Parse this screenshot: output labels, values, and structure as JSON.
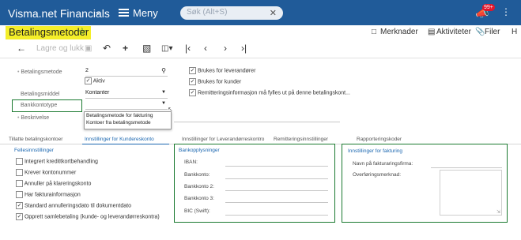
{
  "topbar": {
    "app_name": "Visma.net Financials",
    "menu_label": "Meny",
    "search_placeholder": "Søk (Alt+S)",
    "notification_count": "99+"
  },
  "header": {
    "title": "Betalingsmetoder",
    "actions": [
      "Merknader",
      "Aktiviteter",
      "Filer",
      "H"
    ]
  },
  "toolbar": {
    "save_close": "Lagre og lukk"
  },
  "form": {
    "betalingsmetode_label": "Betalingsmetode",
    "betalingsmetode_value": "2",
    "aktiv_label": "Aktiv",
    "betalingsmiddel_label": "Betalingsmiddel",
    "betalingsmiddel_value": "Kontanter",
    "bankkontotype_label": "Bankkontotype",
    "beskrivelse_label": "Beskrivelse",
    "checks_right": [
      "Brukes for leverandører",
      "Brukes for kunder",
      "Remitteringsinformasjon må fylles ut på denne betalingskont..."
    ],
    "dropdown_options": [
      "Betalingsmetode for fakturing",
      "Kontoer fra betalingsmetode"
    ]
  },
  "tabs": [
    "Tillatte betalingskontoer",
    "Innstillinger for Kundereskonto",
    "Innstillinger for Leverandørreskontro",
    "Remitteringsinnstillinger",
    "Rapporteringskoder"
  ],
  "fellesinnstillinger": {
    "title": "Fellesinnstillinger",
    "items": [
      {
        "label": "Integrert kredittkortbehandling",
        "checked": false
      },
      {
        "label": "Krever kontonummer",
        "checked": false
      },
      {
        "label": "Annuller på klareringskonto",
        "checked": false
      },
      {
        "label": "Har fakturainformasjon",
        "checked": false
      },
      {
        "label": "Standard annulleringsdato til dokumentdato",
        "checked": true
      },
      {
        "label": "Opprett samlebetaling (kunde- og leverandørreskontra)",
        "checked": true
      }
    ]
  },
  "bankopplysninger": {
    "title": "Bankopplysninger",
    "fields": [
      "IBAN:",
      "Bankkonto:",
      "Bankkonto 2:",
      "Bankkonto 3:",
      "BIC (Swift):"
    ]
  },
  "fakturing": {
    "title": "Innstillinger for fakturing",
    "fields": [
      "Navn på fakturaringsfirma:",
      "Overføringsmerknad:"
    ]
  }
}
